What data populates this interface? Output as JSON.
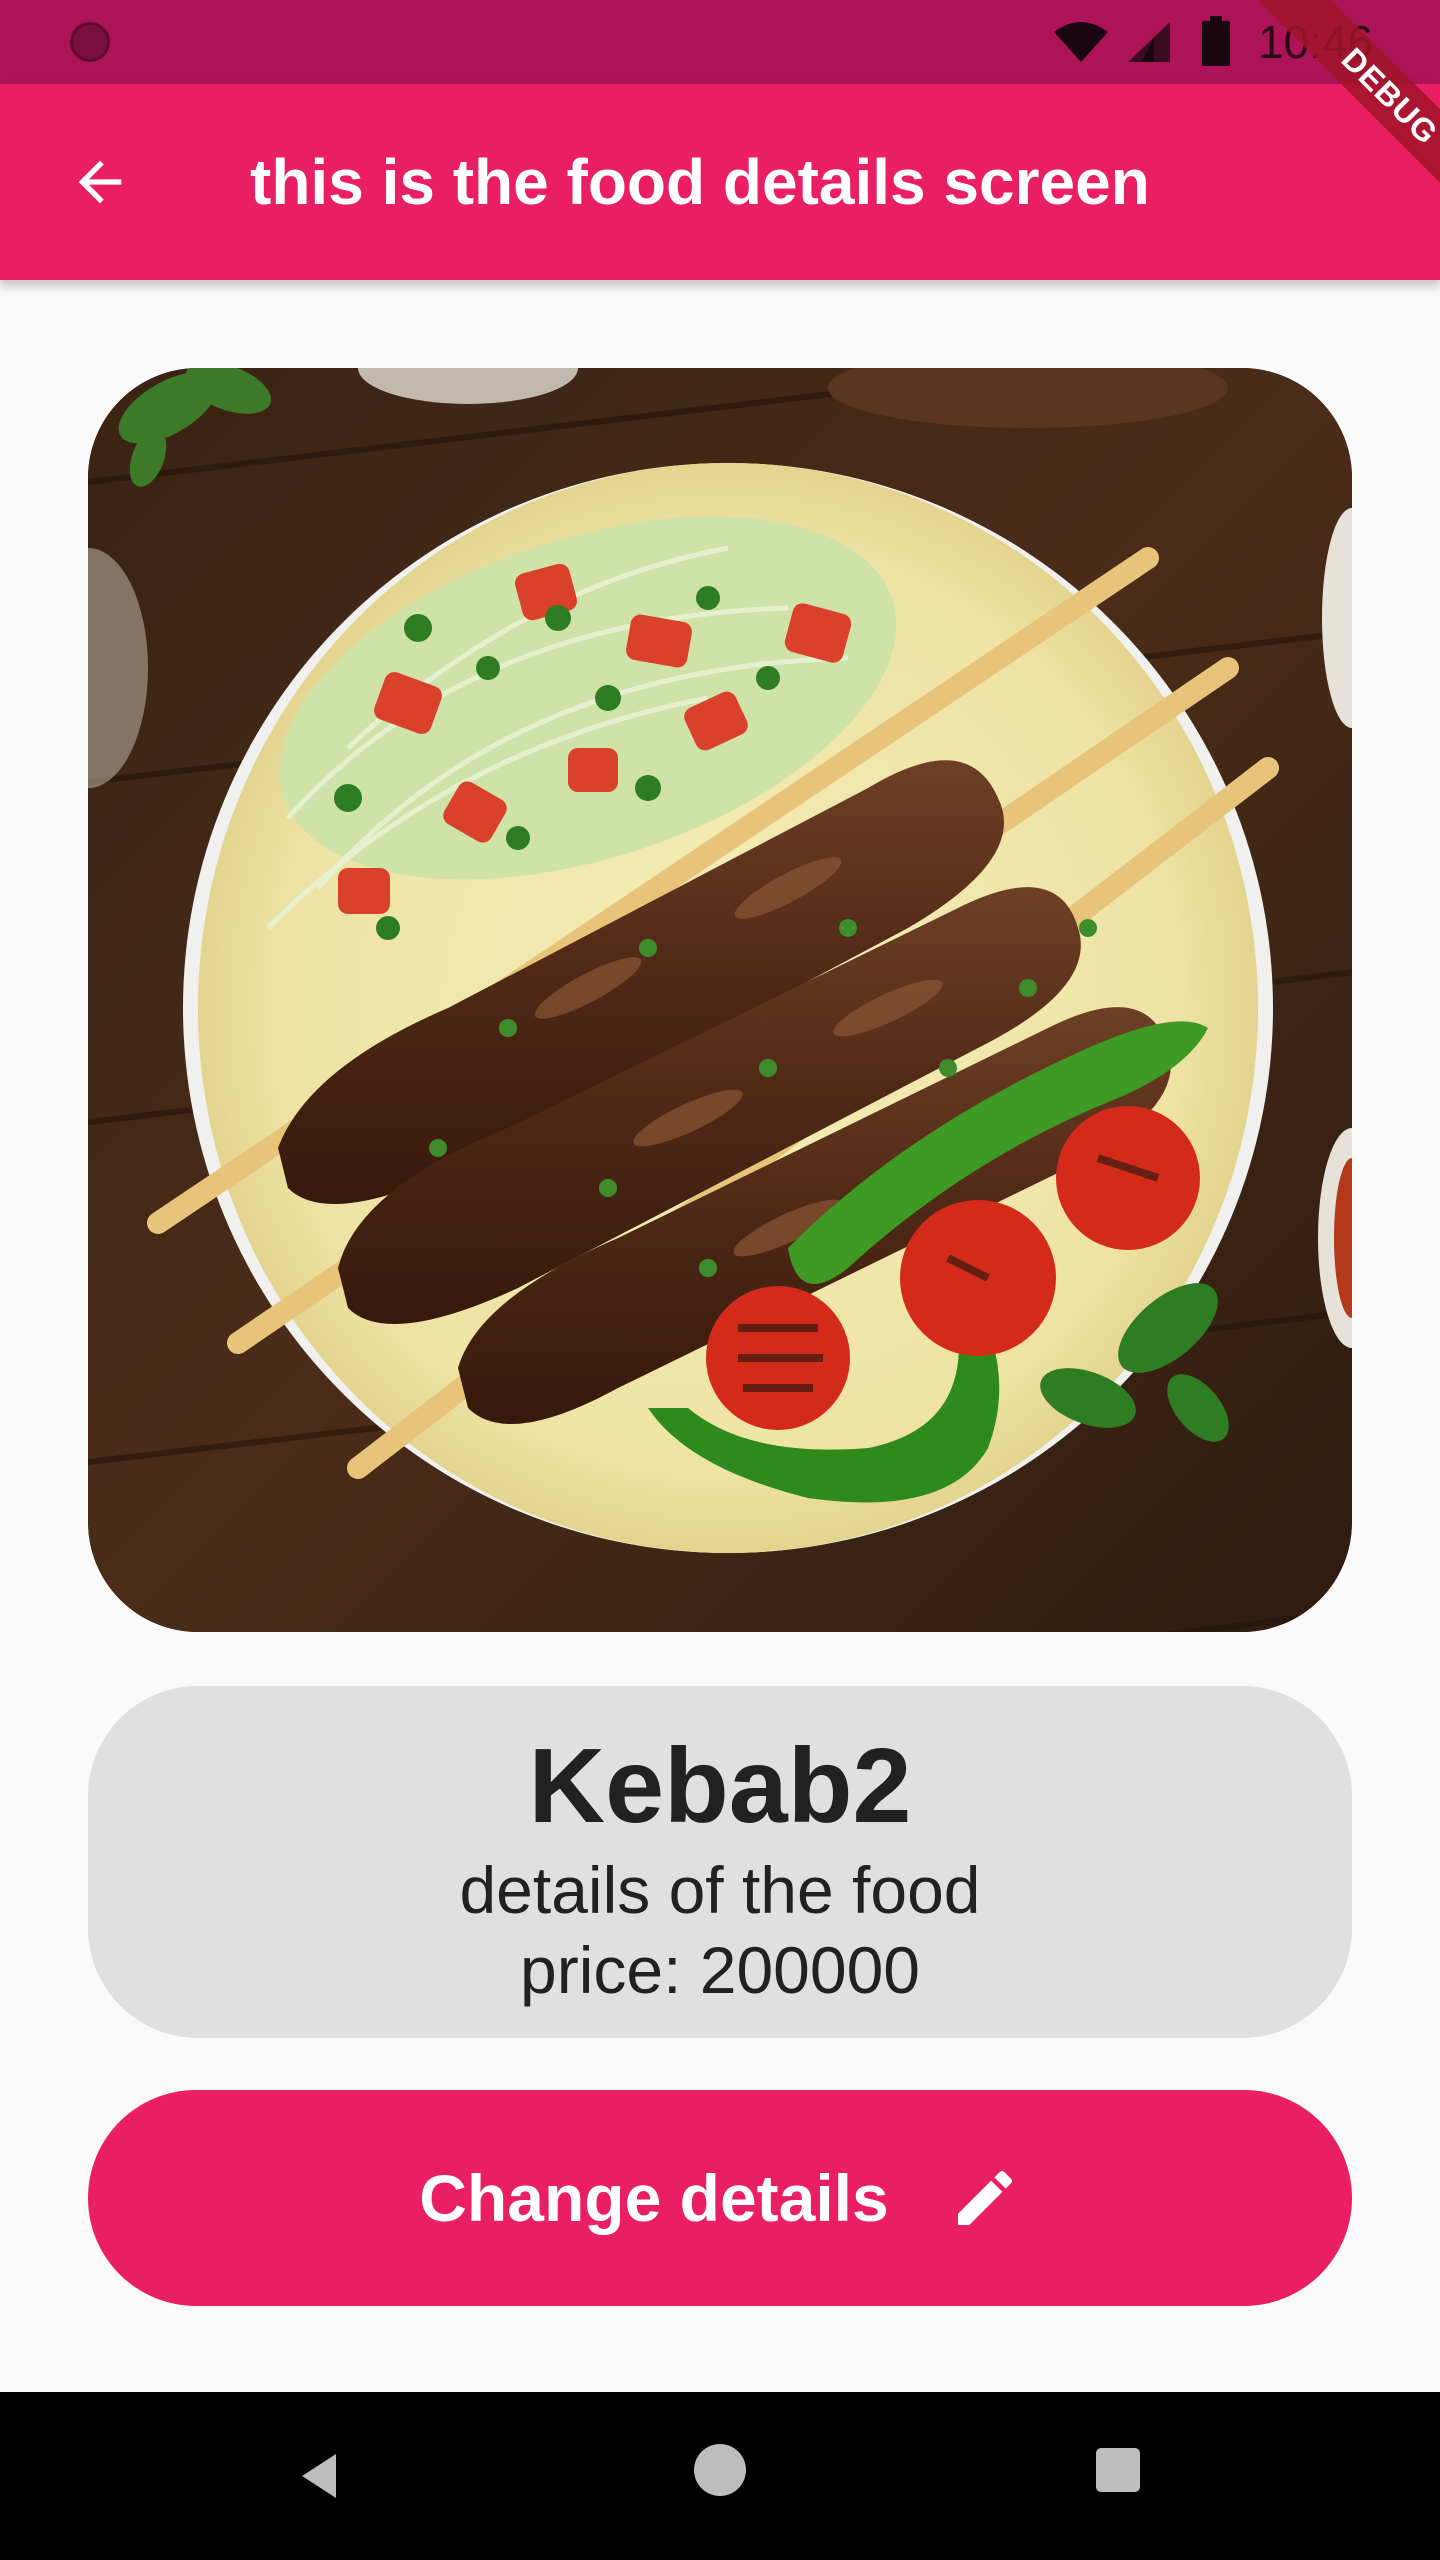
{
  "status_bar": {
    "time": "10:46",
    "icons": [
      "camera-dot-icon",
      "wifi-icon",
      "signal-icon",
      "battery-icon"
    ]
  },
  "app_bar": {
    "title": "this is the food details screen",
    "back_icon": "arrow-back-icon"
  },
  "debug_banner": "DEBUG",
  "food": {
    "image_alt": "kebab-skewers-on-flatbread",
    "name": "Kebab2",
    "details": "details of the food",
    "price": "price: 200000"
  },
  "actions": {
    "change_label": "Change details",
    "change_icon": "edit-pencil-icon"
  },
  "nav_bar": {
    "icons": [
      "nav-back-icon",
      "nav-home-icon",
      "nav-recents-icon"
    ]
  },
  "colors": {
    "primary": "#e91e63",
    "primary_dark": "#ad1457",
    "card_bg": "#e0e0e0",
    "page_bg": "#fafafa"
  }
}
